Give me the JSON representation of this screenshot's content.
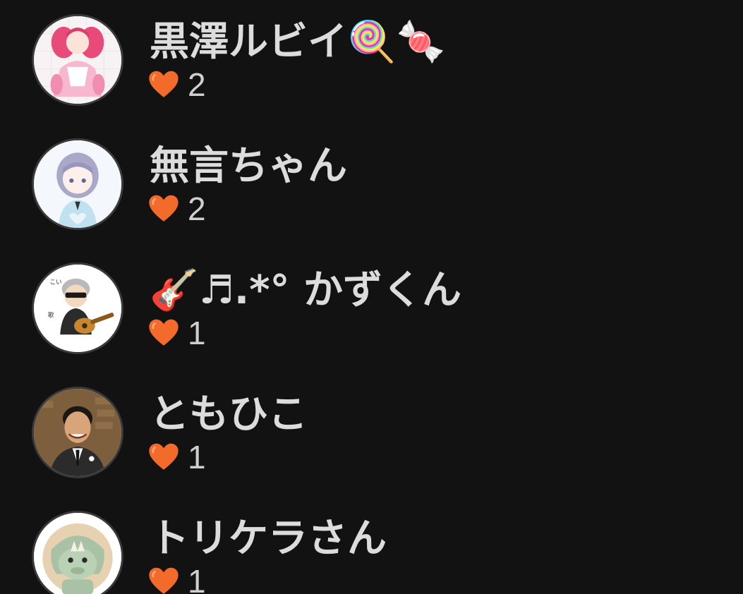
{
  "colors": {
    "background": "#121212",
    "name_text": "#dcdcdc",
    "count_text": "#cfcfcf",
    "heart": "#f26b2a"
  },
  "users": [
    {
      "name": "黒澤ルビイ🍭🍬",
      "likes": "2",
      "avatar_icon": "anime-girl-pink-avatar-icon"
    },
    {
      "name": "無言ちゃん",
      "likes": "2",
      "avatar_icon": "anime-girl-lavender-avatar-icon"
    },
    {
      "name": "🎸♬.*° かずくん",
      "likes": "1",
      "avatar_icon": "guitar-player-avatar-icon"
    },
    {
      "name": "ともひこ",
      "likes": "1",
      "avatar_icon": "man-in-suit-avatar-icon"
    },
    {
      "name": "トリケラさん",
      "likes": "1",
      "avatar_icon": "triceratops-avatar-icon"
    }
  ]
}
